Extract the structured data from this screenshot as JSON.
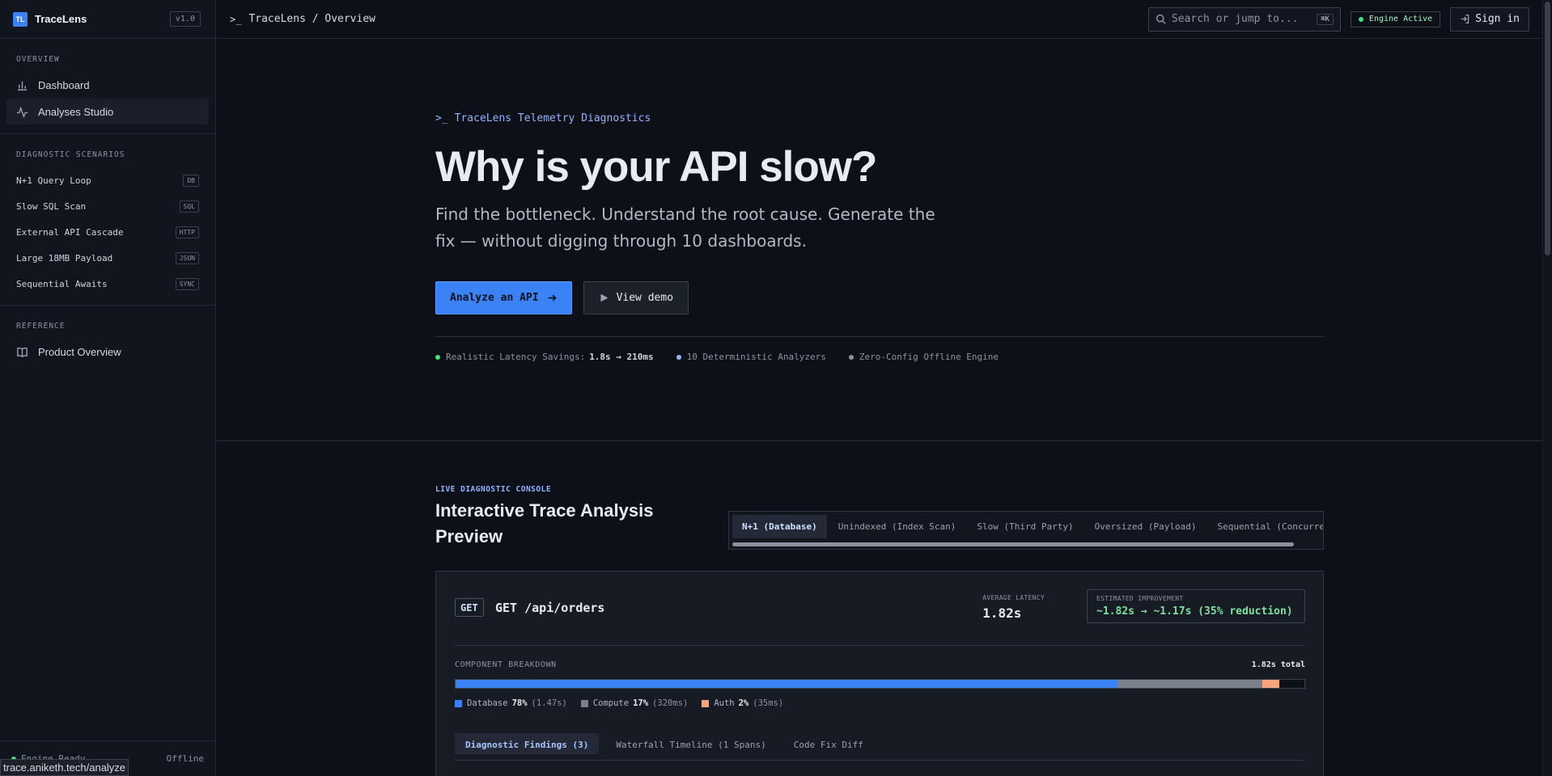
{
  "sidebar": {
    "logo": "TL",
    "brand": "TraceLens",
    "version": "v1.0",
    "overview_label": "OVERVIEW",
    "overview_items": [
      {
        "label": "Dashboard",
        "icon": "bar-chart-icon"
      },
      {
        "label": "Analyses Studio",
        "icon": "activity-icon"
      }
    ],
    "scenarios_label": "DIAGNOSTIC SCENARIOS",
    "scenarios": [
      {
        "label": "N+1 Query Loop",
        "tag": "DB"
      },
      {
        "label": "Slow SQL Scan",
        "tag": "SQL"
      },
      {
        "label": "External API Cascade",
        "tag": "HTTP"
      },
      {
        "label": "Large 18MB Payload",
        "tag": "JSON"
      },
      {
        "label": "Sequential Awaits",
        "tag": "SYNC"
      }
    ],
    "reference_label": "REFERENCE",
    "reference_items": [
      {
        "label": "Product Overview",
        "icon": "book-icon"
      }
    ],
    "footer_status": "Engine Ready",
    "footer_mode": "Offline",
    "url_tooltip": "trace.aniketh.tech/analyze"
  },
  "topbar": {
    "breadcrumb": "TraceLens / Overview",
    "search_placeholder": "Search or jump to...",
    "search_shortcut": "⌘K",
    "engine_status": "Engine Active",
    "signin_label": "Sign in"
  },
  "hero": {
    "eyebrow": "TraceLens Telemetry Diagnostics",
    "headline": "Why is your API slow?",
    "subline": "Find the bottleneck. Understand the root cause. Generate the fix — without digging through 10 dashboards.",
    "primary_cta": "Analyze an API",
    "secondary_cta": "View demo",
    "stats": [
      {
        "label": "Realistic Latency Savings:",
        "value": "1.8s → 210ms",
        "color": "#4ade80"
      },
      {
        "label": "10 Deterministic Analyzers",
        "value": "",
        "color": "#93b4ff"
      },
      {
        "label": "Zero-Config Offline Engine",
        "value": "",
        "color": "#8b93a3"
      }
    ]
  },
  "console": {
    "eyebrow": "LIVE DIAGNOSTIC CONSOLE",
    "title": "Interactive Trace Analysis Preview",
    "tabs": [
      "N+1 (Database)",
      "Unindexed (Index Scan)",
      "Slow (Third Party)",
      "Oversized (Payload)",
      "Sequential (Concurrency)"
    ],
    "active_tab": 0,
    "card": {
      "method": "GET",
      "endpoint": "GET /api/orders",
      "avg_latency_label": "AVERAGE LATENCY",
      "avg_latency": "1.82s",
      "improvement_label": "ESTIMATED IMPROVEMENT",
      "improvement": "~1.82s → ~1.17s (35% reduction)",
      "breakdown_label": "COMPONENT BREAKDOWN",
      "breakdown_total": "1.82s total",
      "components": [
        {
          "name": "Database",
          "percent": 78,
          "percent_label": "78%",
          "ms": "(1.47s)",
          "color": "#3b82f6"
        },
        {
          "name": "Compute",
          "percent": 17,
          "percent_label": "17%",
          "ms": "(320ms)",
          "color": "#7b818c"
        },
        {
          "name": "Auth",
          "percent": 2,
          "percent_label": "2%",
          "ms": "(35ms)",
          "color": "#fba57a"
        }
      ],
      "subtabs": [
        "Diagnostic Findings (3)",
        "Waterfall Timeline (1 Spans)",
        "Code Fix Diff"
      ]
    }
  }
}
